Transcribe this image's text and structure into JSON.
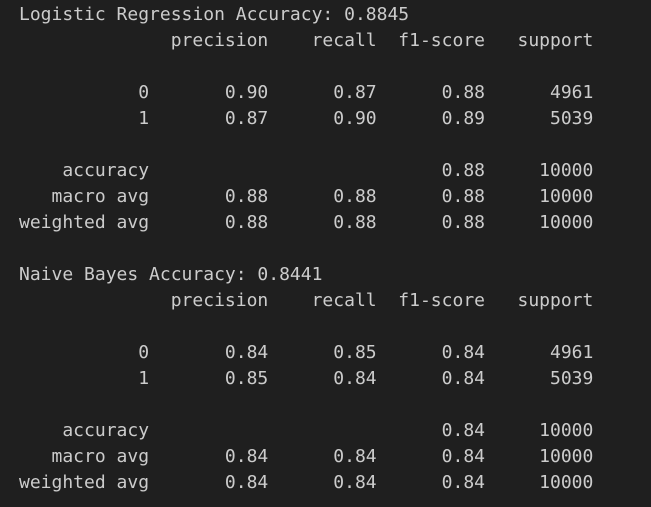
{
  "output": {
    "lines": [
      "Logistic Regression Accuracy: 0.8845",
      "              precision    recall  f1-score   support",
      "",
      "           0       0.90      0.87      0.88      4961",
      "           1       0.87      0.90      0.89      5039",
      "",
      "    accuracy                           0.88     10000",
      "   macro avg       0.88      0.88      0.88     10000",
      "weighted avg       0.88      0.88      0.88     10000",
      "",
      "Naive Bayes Accuracy: 0.8441",
      "              precision    recall  f1-score   support",
      "",
      "           0       0.84      0.85      0.84      4961",
      "           1       0.85      0.84      0.84      5039",
      "",
      "    accuracy                           0.84     10000",
      "   macro avg       0.84      0.84      0.84     10000",
      "weighted avg       0.84      0.84      0.84     10000"
    ]
  }
}
